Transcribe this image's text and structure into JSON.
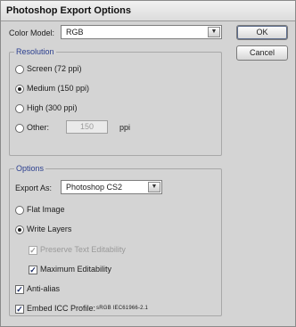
{
  "window": {
    "title": "Photoshop Export Options"
  },
  "color_model": {
    "label": "Color Model:",
    "value": "RGB"
  },
  "buttons": {
    "ok": "OK",
    "cancel": "Cancel"
  },
  "resolution": {
    "legend": "Resolution",
    "options": [
      {
        "label": "Screen (72 ppi)",
        "selected": false
      },
      {
        "label": "Medium (150 ppi)",
        "selected": true
      },
      {
        "label": "High (300 ppi)",
        "selected": false
      },
      {
        "label": "Other:",
        "selected": false
      }
    ],
    "other_value": "150",
    "other_unit": "ppi"
  },
  "options": {
    "legend": "Options",
    "export_as_label": "Export As:",
    "export_as_value": "Photoshop CS2",
    "flat_image": "Flat Image",
    "write_layers": "Write Layers",
    "preserve_text": "Preserve Text Editability",
    "max_editability": "Maximum Editability",
    "anti_alias": "Anti-alias",
    "embed_icc": "Embed ICC Profile:",
    "icc_profile": "sRGB IEC61966-2.1"
  },
  "icons": {
    "dropdown": "chevron-down-icon",
    "check": "checkmark-icon"
  }
}
